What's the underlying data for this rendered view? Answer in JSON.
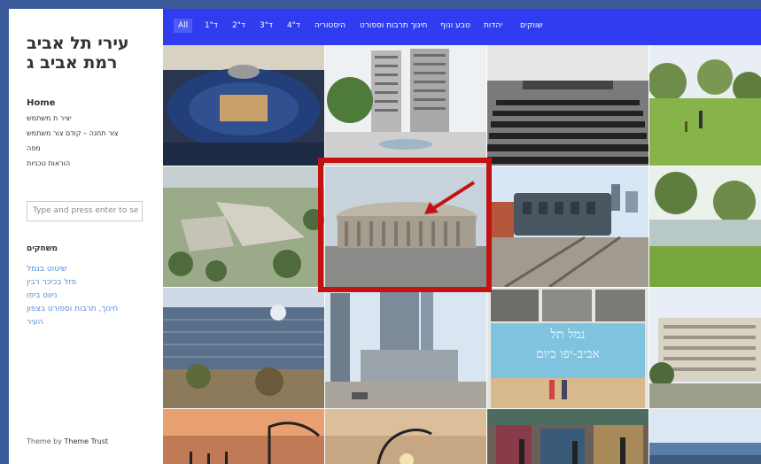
{
  "sidebar": {
    "title_line1": "עירי תל אביב",
    "title_line2": "רמת אביב ג",
    "nav": [
      "Home",
      "יציר ת משתמש",
      "צור תחנה – קודם צור משתמש",
      "מפה",
      "הוראות טכניות"
    ],
    "search_placeholder": "Type and press enter to se",
    "widget_title": "משחקים",
    "links": [
      "שיטוט בנמל",
      "פזל בכיכר רבין",
      "ניווט ביפו",
      "חינוך, תרבות וספורט בצפון",
      "העיר"
    ],
    "credit_prefix": "Theme by",
    "credit_name": "Theme Trust"
  },
  "filters": {
    "all": "All",
    "items": [
      "1\"ד",
      "2\"ד",
      "3\"ד",
      "4\"ד",
      "היסטוריה",
      "חינוך תרבות וספורט",
      "טבע ונוף",
      "יהדות",
      "שווקים"
    ]
  },
  "tiles": [
    "basketball-arena",
    "university-building",
    "auditorium-seats",
    "park-lawn",
    "campus-aerial",
    "round-arena-building",
    "railway-carriage",
    "riverside-park",
    "modern-glass-building",
    "azrieli-towers",
    "tel-aviv-port-sign",
    "office-building",
    "sunset-lamp",
    "street-lamp",
    "market-stalls",
    "sea-view"
  ],
  "tile_text": {
    "port_sign_line1": "נמל תל",
    "port_sign_line2": "אביב-יפו ביום"
  }
}
